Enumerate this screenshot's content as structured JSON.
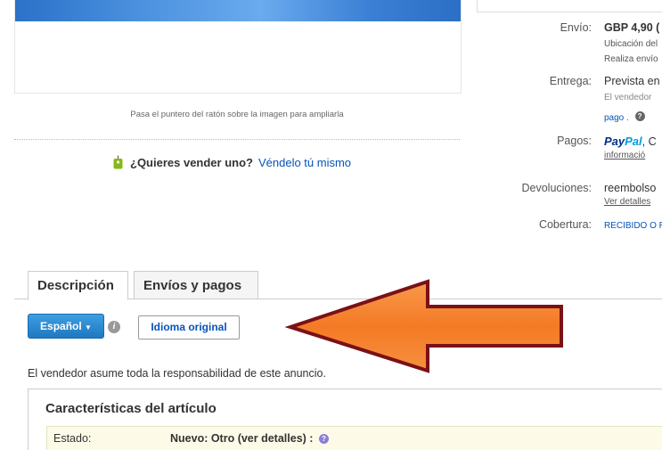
{
  "image_panel": {
    "hover_hint": "Pasa el puntero del ratón sobre la imagen para ampliarla"
  },
  "sell": {
    "question": "¿Quieres vender uno?",
    "link": "Véndelo tú mismo"
  },
  "details": {
    "shipping_label": "Envío:",
    "shipping_value": "GBP 4,90 (",
    "shipping_location": "Ubicación del",
    "shipping_note": "Realiza envío",
    "delivery_label": "Entrega:",
    "delivery_value": "Prevista en",
    "delivery_seller": "El vendedor",
    "delivery_link": "pago",
    "payments_label": "Pagos:",
    "paypal_pay": "Pay",
    "paypal_pal": "Pal",
    "payments_more": "informació",
    "payments_trail": "C",
    "returns_label": "Devoluciones:",
    "returns_value": "reembolso",
    "returns_link": "Ver detalles",
    "coverage_label": "Cobertura:",
    "coverage_value": "RECIBIDO O R"
  },
  "tabs": [
    {
      "label": "Descripción"
    },
    {
      "label": "Envíos y pagos"
    }
  ],
  "language": {
    "selected": "Español",
    "original_button": "Idioma original"
  },
  "seller_note": "El vendedor asume toda la responsabilidad de este anuncio.",
  "characteristics": {
    "title": "Características del artículo",
    "state_label": "Estado:",
    "state_value": "Nuevo: Otro (ver detalles) :"
  },
  "colors": {
    "link": "#0654ba",
    "arrow_fill": "#f57f2a",
    "arrow_stroke": "#7a1116",
    "button_blue": "#2a88d2"
  }
}
